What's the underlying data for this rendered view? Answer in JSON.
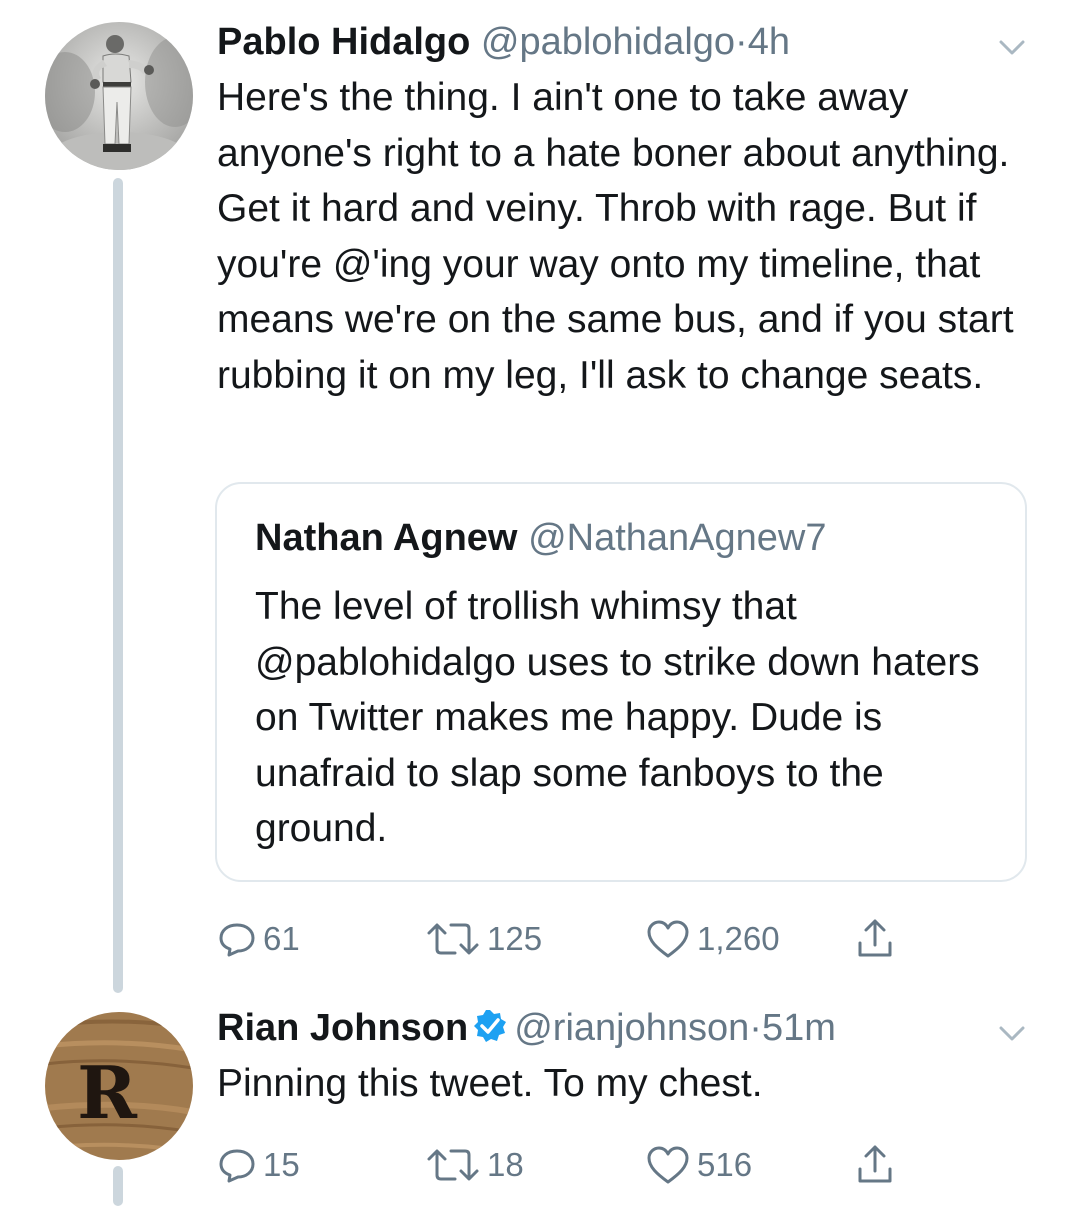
{
  "tweets": [
    {
      "author_name": "Pablo Hidalgo",
      "handle": "@pablohidalgo",
      "separator": "·",
      "time": "4h",
      "text": "Here's the thing. I ain't one to take away anyone's right to a hate boner about anything. Get it hard and veiny. Throb with rage. But if you're @'ing your way onto my timeline, that means we're on the same bus, and if you start rubbing it on my leg, I'll ask to change seats.",
      "quoted": {
        "author_name": "Nathan Agnew",
        "handle": "@NathanAgnew7",
        "text": "The level of trollish whimsy that @pablohidalgo uses to strike down haters on Twitter makes me happy. Dude is unafraid to slap some fanboys to the ground."
      },
      "replies": "61",
      "retweets": "125",
      "likes": "1,260"
    },
    {
      "author_name": "Rian Johnson",
      "verified": true,
      "handle": "@rianjohnson",
      "separator": "·",
      "time": "51m",
      "avatar_letter": "R",
      "text": "Pinning this tweet. To my chest.",
      "replies": "15",
      "retweets": "18",
      "likes": "516"
    }
  ],
  "icons": {
    "reply": "reply-icon",
    "retweet": "retweet-icon",
    "like": "heart-icon",
    "share": "share-icon",
    "menu": "chevron-down-icon",
    "verified": "verified-badge-icon"
  },
  "colors": {
    "text": "#14171a",
    "secondary": "#657786",
    "verified": "#1da1f2",
    "thread_line": "#ccd6dd",
    "quote_border": "#e1e8ed"
  }
}
